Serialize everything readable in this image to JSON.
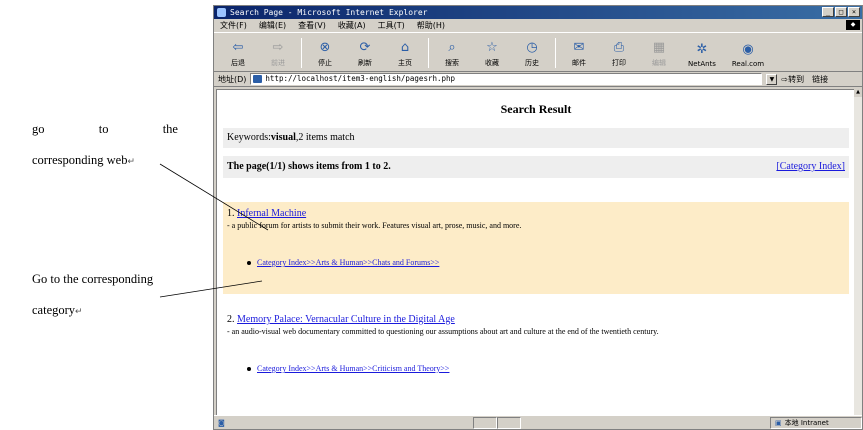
{
  "annotations": {
    "go_words": [
      "go",
      "to",
      "the"
    ],
    "web_line": "corresponding web",
    "cat_line1": "Go to the corresponding",
    "cat_line2": "category",
    "return_mark": "↵"
  },
  "window": {
    "title": "Search Page - Microsoft Internet Explorer",
    "controls": [
      "_",
      "□",
      "×"
    ]
  },
  "menu": [
    "文件(F)",
    "编辑(E)",
    "查看(V)",
    "收藏(A)",
    "工具(T)",
    "帮助(H)"
  ],
  "toolbar": [
    {
      "label": "后退",
      "icon": "back-arrow-icon",
      "glyph": "⇦"
    },
    {
      "label": "前进",
      "icon": "forward-arrow-icon",
      "glyph": "⇨"
    },
    {
      "label": "停止",
      "icon": "stop-icon",
      "glyph": "⊗"
    },
    {
      "label": "刷新",
      "icon": "refresh-icon",
      "glyph": "⟳"
    },
    {
      "label": "主页",
      "icon": "home-icon",
      "glyph": "⌂"
    },
    {
      "label": "搜索",
      "icon": "search-icon",
      "glyph": "⌕"
    },
    {
      "label": "收藏",
      "icon": "favorites-icon",
      "glyph": "☆"
    },
    {
      "label": "历史",
      "icon": "history-icon",
      "glyph": "◷"
    },
    {
      "label": "邮件",
      "icon": "mail-icon",
      "glyph": "✉"
    },
    {
      "label": "打印",
      "icon": "print-icon",
      "glyph": "⎙"
    },
    {
      "label": "编辑",
      "icon": "edit-icon",
      "glyph": "▦"
    },
    {
      "label": "NetAnts",
      "icon": "netants-icon",
      "glyph": "✲"
    },
    {
      "label": "Real.com",
      "icon": "real-icon",
      "glyph": "◉"
    }
  ],
  "address": {
    "label": "地址(D)",
    "url": "http://localhost/item3-english/pagesrh.php",
    "go": "转到",
    "links": "链接"
  },
  "page": {
    "title": "Search Result",
    "keywords_prefix": "Keywords:",
    "keyword": "visual",
    "match_text": ",2 items match",
    "pages_text": "The page(1/1) shows items from 1 to 2.",
    "category_index": "[Category Index]",
    "items": [
      {
        "num": "1.",
        "title": "Infernal Machine",
        "desc": "- a public forum for artists to submit their work. Features visual art, prose, music, and more.",
        "category": "Category Index>>Arts & Human>>Chats and Forums>>"
      },
      {
        "num": "2.",
        "title": "Memory Palace: Vernacular Culture in the Digital Age",
        "desc": "- an audio-visual web documentary committed to questioning our assumptions about art and culture at the end of the twentieth century.",
        "category": "Category Index>>Arts & Human>>Criticism and Theory>>"
      }
    ]
  },
  "status": {
    "zone": "本地 Intranet"
  },
  "colors": {
    "highlight": "#fdecc8",
    "link": "#1a1adc",
    "titlebar": "#0a246a"
  }
}
